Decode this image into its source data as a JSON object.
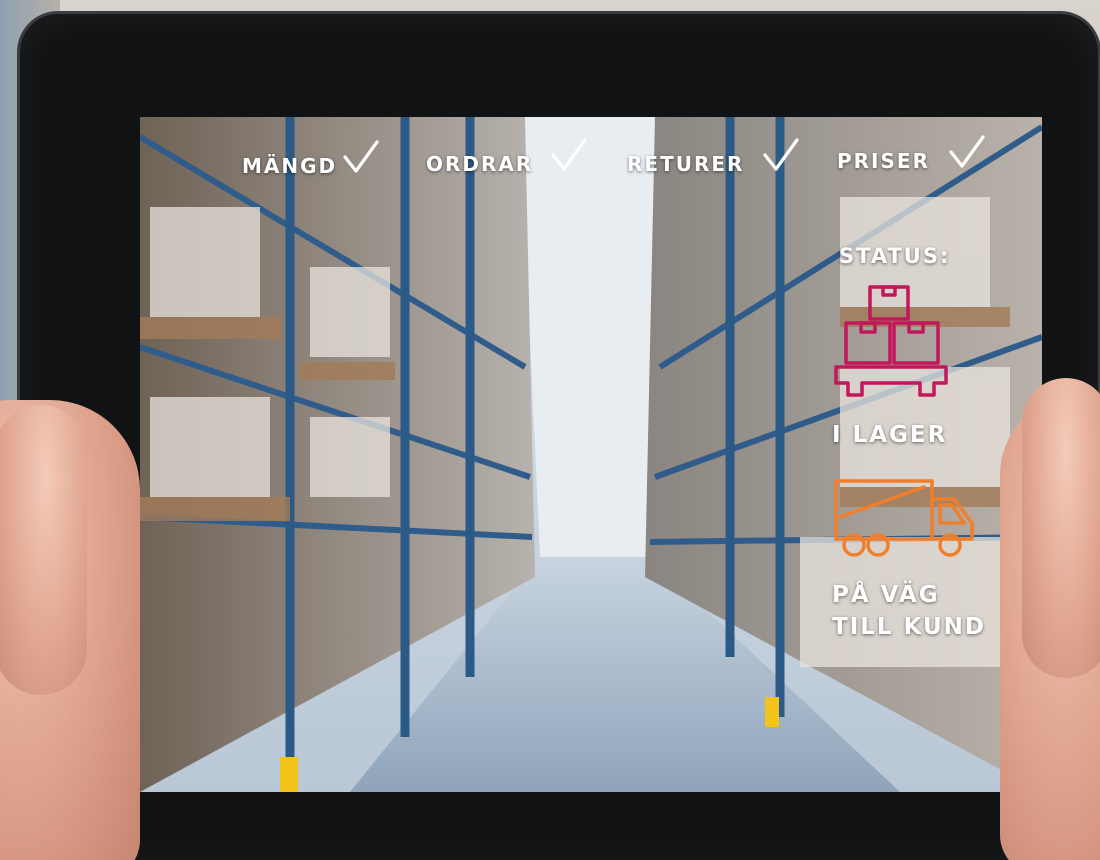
{
  "checklist": [
    {
      "label": "MÄNGD"
    },
    {
      "label": "ORDRAR"
    },
    {
      "label": "RETURER"
    },
    {
      "label": "PRISER"
    }
  ],
  "status": {
    "title": "STATUS:",
    "in_stock_label": "I LAGER",
    "on_the_way_line1": "PÅ VÄG",
    "on_the_way_line2": "TILL KUND"
  },
  "colors": {
    "in_stock_icon": "#c2185b",
    "delivery_icon": "#f07f2c",
    "label_text": "#ffffff"
  },
  "icons": {
    "check": "checkmark-icon",
    "in_stock": "boxes-on-pallet-icon",
    "delivery": "delivery-truck-icon"
  }
}
